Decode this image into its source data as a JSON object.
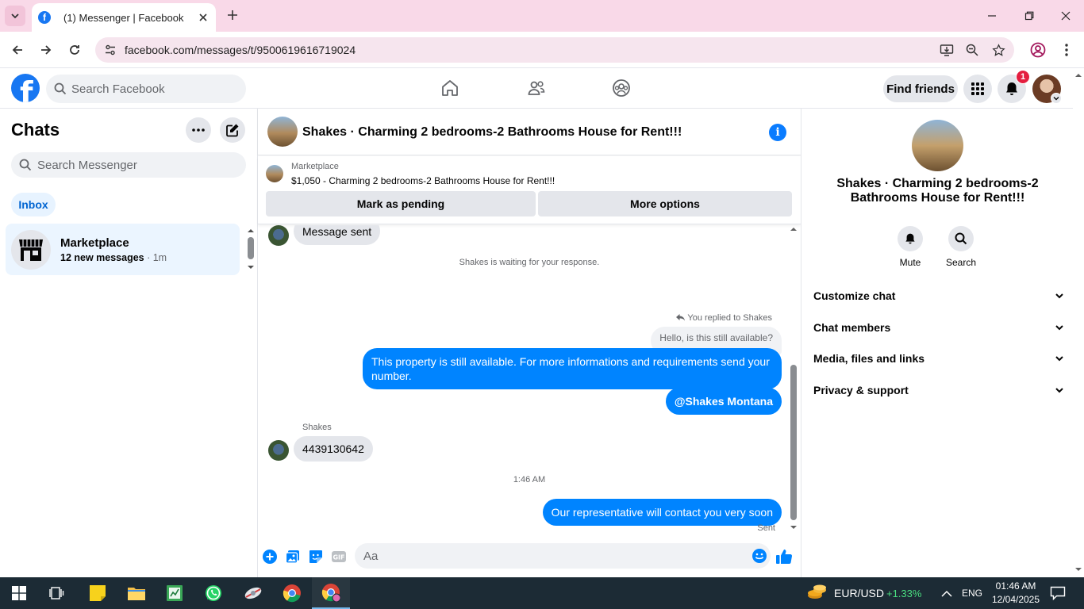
{
  "browser": {
    "tab_title": "(1) Messenger | Facebook",
    "url": "facebook.com/messages/t/9500619616719024"
  },
  "header": {
    "search_placeholder": "Search Facebook",
    "find_friends_label": "Find friends",
    "notification_count": "1"
  },
  "sidebar": {
    "title": "Chats",
    "search_placeholder": "Search Messenger",
    "filter_label": "Inbox",
    "chats": [
      {
        "name": "Marketplace",
        "preview": "12 new messages",
        "time": " · 1m"
      }
    ]
  },
  "conversation": {
    "title": "Shakes · Charming 2 bedrooms-2 Bathrooms House for Rent!!!",
    "marketplace_label": "Marketplace",
    "listing": "$1,050 - Charming 2 bedrooms-2 Bathrooms House for Rent!!!",
    "mark_pending_label": "Mark as pending",
    "more_options_label": "More options",
    "messages": {
      "top_partial": "Message sent",
      "waiting_notice": "Shakes is waiting for your response.",
      "reply_indicator": "You replied to Shakes",
      "replied_to_text": "Hello, is this still available?",
      "outgoing_1": "This property is still available. For more informations and requirements send your number.",
      "outgoing_2": "@Shakes Montana",
      "sender_name": "Shakes",
      "incoming_1": "4439130642",
      "timestamp": "1:46 AM",
      "outgoing_3": "Our representative will contact you very soon",
      "status": "Sent"
    },
    "composer_placeholder": "Aa"
  },
  "details": {
    "title": "Shakes · Charming 2 bedrooms-2 Bathrooms House for Rent!!!",
    "actions": [
      {
        "label": "Mute",
        "icon": "bell-icon"
      },
      {
        "label": "Search",
        "icon": "search-icon"
      }
    ],
    "sections": [
      "Customize chat",
      "Chat members",
      "Media, files and links",
      "Privacy & support"
    ]
  },
  "taskbar": {
    "ticker_pair": "EUR/USD",
    "ticker_change": "+1.33%",
    "language": "ENG",
    "time": "01:46 AM",
    "date": "12/04/2025"
  },
  "colors": {
    "fb_blue": "#1877f2",
    "messenger_blue": "#0084ff",
    "tab_strip": "#f9d9e8",
    "ticker_green": "#4ade80"
  }
}
